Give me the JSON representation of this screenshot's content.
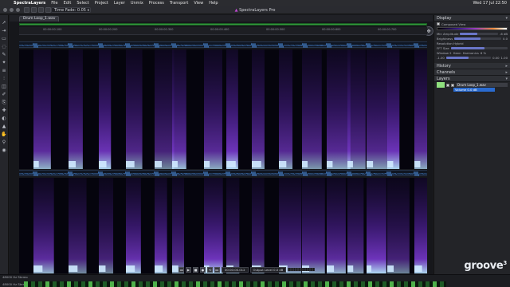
{
  "menubar": {
    "apple": "",
    "app": "SpectraLayers",
    "items": [
      "File",
      "Edit",
      "Select",
      "Project",
      "Layer",
      "Unmix",
      "Process",
      "Transport",
      "View",
      "Help"
    ],
    "clock": "Wed 17 Jul  22:50"
  },
  "window": {
    "title": "SpectraLayers Pro",
    "time_fade": "Time Fade: 0.05 s"
  },
  "tab": {
    "label": "Drum Loop_1.wav"
  },
  "ruler": {
    "ticks": [
      "00:00:00.100",
      "00:00:00.200",
      "00:00:00.300",
      "00:00:00.400",
      "00:00:00.500",
      "00:00:00.600",
      "00:00:00.700"
    ]
  },
  "yaxis": {
    "top": [
      "20k",
      "10k",
      "5k",
      "2k",
      "1k",
      "500",
      "200"
    ],
    "bottom": [
      "20k",
      "10k",
      "5k",
      "2k",
      "1k",
      "500",
      "200"
    ]
  },
  "panel": {
    "display": {
      "header": "Display",
      "composed_view": "Composed View",
      "min_amplitude": "Min Amplitude",
      "max_amplitude": "Max Amplitude",
      "max_amplitude_value": "-6 dB",
      "brightness": "Brightness",
      "brightness_value": "0.0",
      "fft_section": "Resolution Hybrid",
      "fft_size": "FFT Size",
      "window_type": "Window 2",
      "hann": "Hann",
      "harmonics": "Harmonics",
      "harmonics_value": "6 %",
      "min_val": "-1.00",
      "mid_val": "0.00",
      "max_val": "1.00"
    },
    "history": {
      "header": "History"
    },
    "channels": {
      "header": "Channels"
    },
    "layers": {
      "header": "Layers",
      "layer_name": "Drum Loop_1.wav",
      "sub_label": "Volume 0.0 dB"
    }
  },
  "status": {
    "format_top": "48000 Hz Stereo",
    "format_bottom": "48000 Hz Stereo"
  },
  "transport": {
    "position": "00:00:00.012",
    "output_label": "Output Level",
    "output_value": "0.0 dB",
    "position_bottom": "00:00:00.012",
    "output_bottom": "Output Level  0.0 dB"
  },
  "watermark": {
    "text": "groove",
    "sup": "3"
  },
  "colors": {
    "accent": "#2f9a3a",
    "spectrogram_low": "#05040d",
    "spectrogram_mid": "#6a2bb8",
    "spectrogram_high": "#8fd8ff",
    "layer_thumb": "#8fe07e",
    "selection": "#2a6bd0"
  }
}
